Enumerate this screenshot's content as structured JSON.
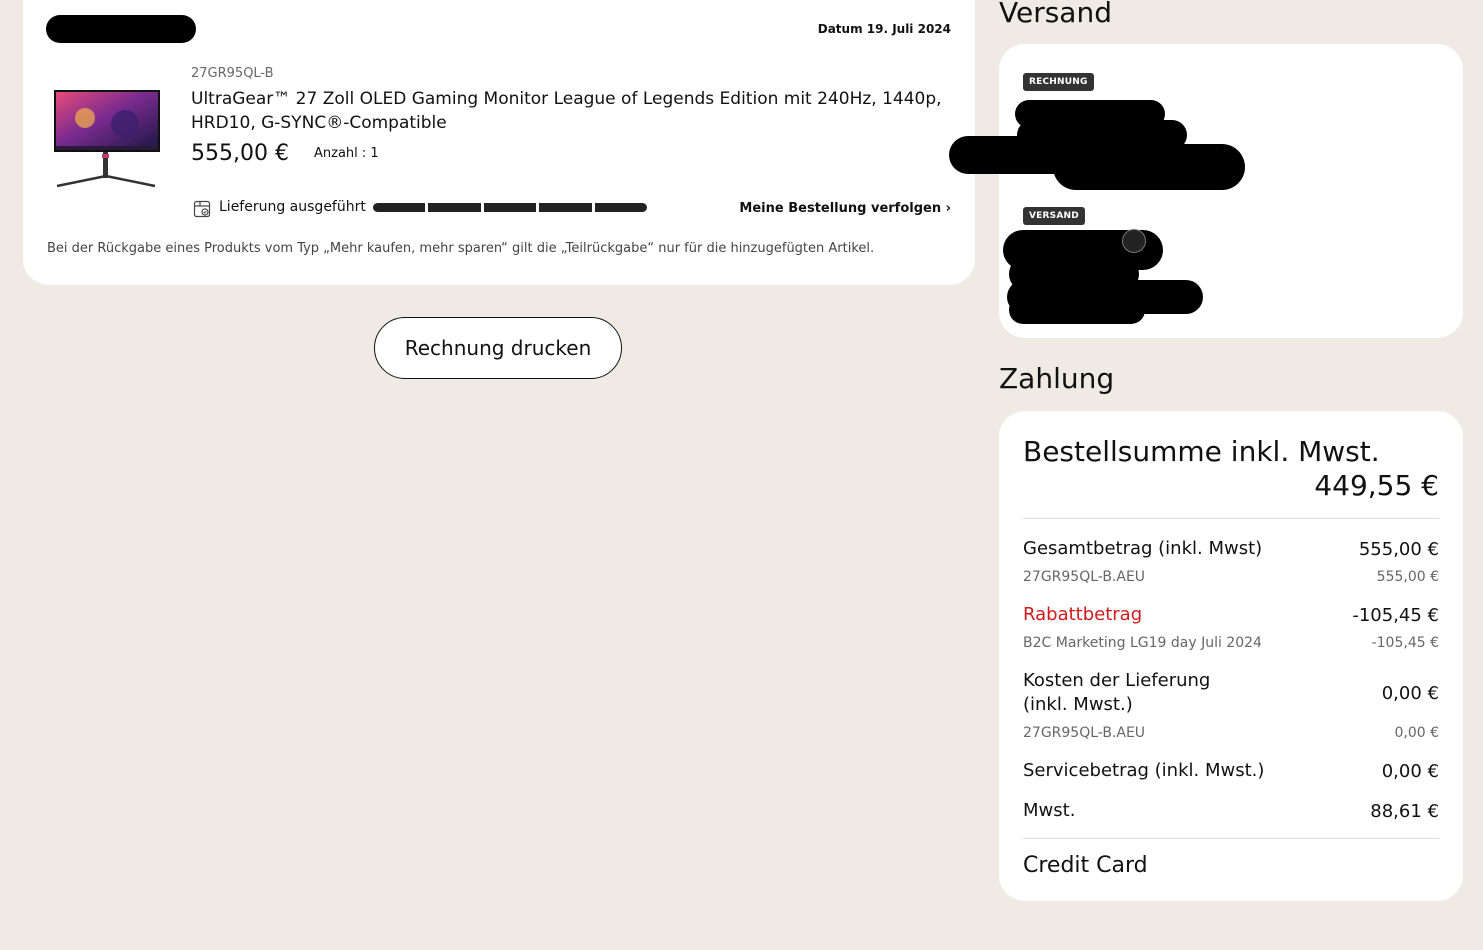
{
  "order": {
    "date": "Datum 19. Juli 2024",
    "product": {
      "model": "27GR95QL-B",
      "title": "UltraGear™ 27 Zoll OLED Gaming Monitor League of Legends Edition mit 240Hz, 1440p, HRD10, G-SYNC®-Compatible",
      "price": "555,00 €",
      "quantity": "Anzahl : 1"
    },
    "delivery": {
      "status": "Lieferung ausgeführt",
      "progress": 1.0,
      "track_link": "Meine Bestellung verfolgen"
    },
    "return_note": "Bei der Rückgabe eines Produkts vom Typ „Mehr kaufen, mehr sparen“ gilt die „Teilrückgabe“ nur für die hinzugefügten Artikel."
  },
  "print_button": "Rechnung drucken",
  "shipping": {
    "heading": "Versand",
    "invoice_badge": "RECHNUNG",
    "shipping_badge": "VERSAND"
  },
  "payment": {
    "heading": "Zahlung",
    "total_label": "Bestellsumme inkl. Mwst.",
    "total_value": "449,55 €",
    "rows": {
      "gross_label": "Gesamtbetrag (inkl. Mwst)",
      "gross_value": "555,00 €",
      "gross_sub_label": "27GR95QL-B.AEU",
      "gross_sub_value": "555,00 €",
      "discount_label": "Rabattbetrag",
      "discount_value": "-105,45 €",
      "discount_sub_label": "B2C Marketing LG19 day Juli 2024",
      "discount_sub_value": "-105,45 €",
      "delivery_label_1": "Kosten der Lieferung",
      "delivery_label_2": "(inkl. Mwst.)",
      "delivery_value": "0,00 €",
      "delivery_sub_label": "27GR95QL-B.AEU",
      "delivery_sub_value": "0,00 €",
      "service_label": "Servicebetrag (inkl. Mwst.)",
      "service_value": "0,00 €",
      "vat_label": "Mwst.",
      "vat_value": "88,61 €"
    },
    "method": "Credit Card"
  },
  "colors": {
    "page_background": "#efebe4",
    "discount_red": "#d11a1a",
    "badge": "#333333"
  }
}
